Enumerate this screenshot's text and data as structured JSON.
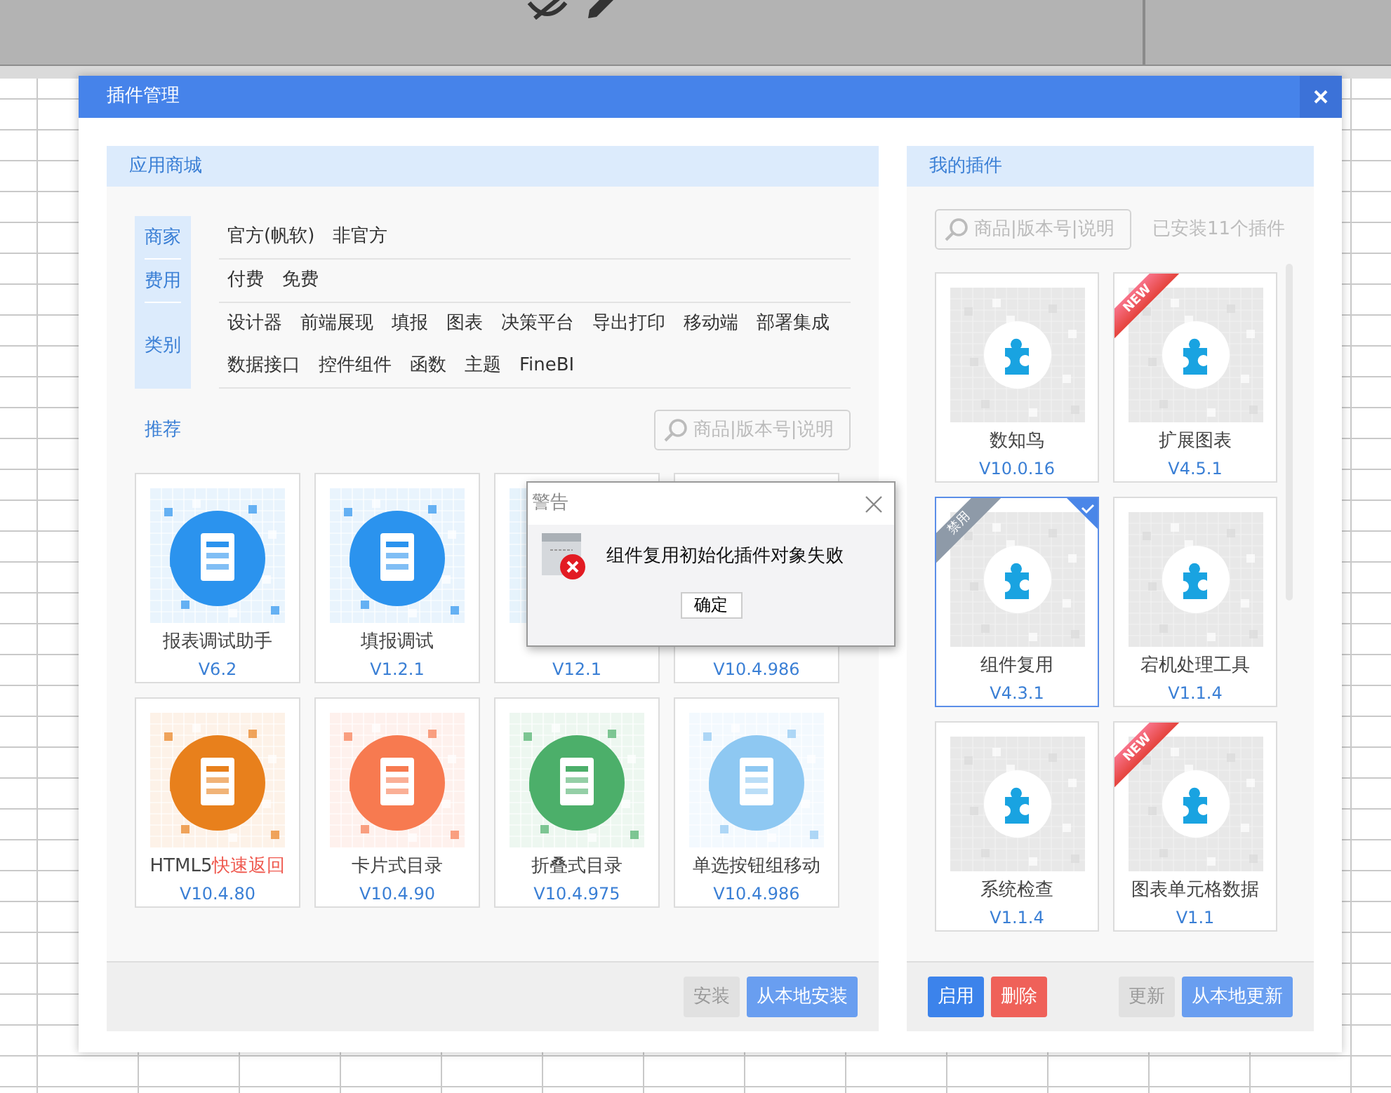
{
  "window": {
    "title": "插件管理"
  },
  "store": {
    "title": "应用商城",
    "filters": [
      {
        "label": "商家",
        "lines": [
          [
            "官方(帆软)",
            "非官方"
          ]
        ]
      },
      {
        "label": "费用",
        "lines": [
          [
            "付费",
            "免费"
          ]
        ]
      },
      {
        "label": "类别",
        "lines": [
          [
            "设计器",
            "前端展现",
            "填报",
            "图表",
            "决策平台",
            "导出打印",
            "移动端",
            "部署集成"
          ],
          [
            "数据接口",
            "控件组件",
            "函数",
            "主题",
            "FineBI"
          ]
        ]
      }
    ],
    "section": "推荐",
    "search": {
      "placeholder": "商品|版本号|说明"
    },
    "items": [
      {
        "name": "报表调试助手",
        "version": "V6.2",
        "color": "#2b93ee"
      },
      {
        "name": "填报调试",
        "version": "V1.2.1",
        "color": "#2b93ee"
      },
      {
        "version": "V12.1"
      },
      {
        "version": "V10.4.986"
      },
      {
        "name": "HTML5",
        "name_highlight": "快速返回",
        "version": "V10.4.80",
        "color": "#e8801c"
      },
      {
        "name": "卡片式目录",
        "version": "V10.4.90",
        "color": "#f77a50"
      },
      {
        "name": "折叠式目录",
        "version": "V10.4.975",
        "color": "#4caf6a"
      },
      {
        "name": "单选按钮组移动",
        "version": "V10.4.986",
        "color": "#8ec8f2"
      }
    ],
    "actions_right": [
      {
        "label": "安装",
        "kind": "plain",
        "disabled": true
      },
      {
        "label": "从本地安装",
        "kind": "light",
        "disabled": false
      }
    ]
  },
  "mine": {
    "title": "我的插件",
    "search": {
      "placeholder": "商品|版本号|说明"
    },
    "installed": "已安装11个插件",
    "items": [
      {
        "name": "数知鸟",
        "version": "V10.0.16",
        "selected": false
      },
      {
        "name": "扩展图表",
        "version": "V4.5.1",
        "ribbon": {
          "kind": "new",
          "text": "NEW"
        },
        "selected": false
      },
      {
        "name": "组件复用",
        "version": "V4.3.1",
        "ribbon": {
          "kind": "disabled",
          "text": "禁用"
        },
        "selected": true
      },
      {
        "name": "宕机处理工具",
        "version": "V1.1.4",
        "selected": false
      },
      {
        "name": "系统检查",
        "version": "V1.1.4",
        "selected": false
      },
      {
        "name": "图表单元格数据",
        "version": "V1.1",
        "ribbon": {
          "kind": "new",
          "text": "NEW"
        },
        "selected": false
      }
    ],
    "actions_left": [
      {
        "label": "启用",
        "kind": "primary",
        "disabled": false
      },
      {
        "label": "删除",
        "kind": "danger",
        "disabled": false
      }
    ],
    "actions_right": [
      {
        "label": "更新",
        "kind": "plain",
        "disabled": true
      },
      {
        "label": "从本地更新",
        "kind": "light",
        "disabled": false
      }
    ]
  },
  "dialog": {
    "title": "警告",
    "message": "组件复用初始化插件对象失败",
    "button": "确定"
  }
}
